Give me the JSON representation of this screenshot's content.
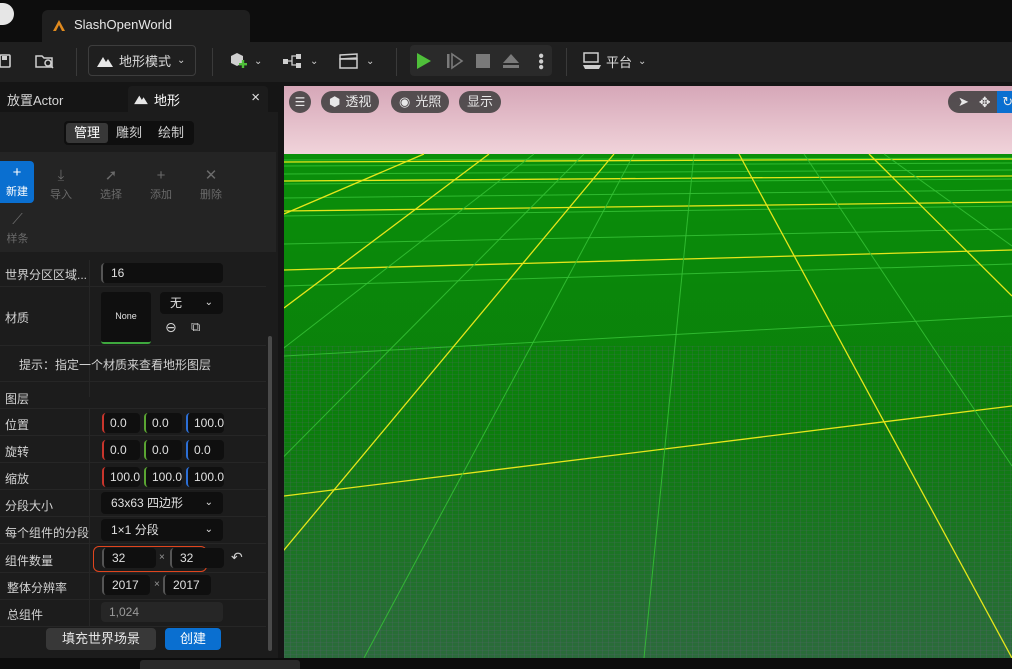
{
  "app": {
    "tab_title": "SlashOpenWorld",
    "logo_icon": "unreal-logo-icon",
    "accent_color": "#0a6fd0"
  },
  "toolbar": {
    "mode_label": "地形模式",
    "platform_label": "平台",
    "play_color": "#4fbf3a"
  },
  "left_panel": {
    "tabs": [
      {
        "label": "放置Actor"
      },
      {
        "label": "地形",
        "close": "×"
      }
    ],
    "segments": [
      "管理",
      "雕刻",
      "绘制"
    ],
    "active_segment": "管理",
    "tools": [
      {
        "label": "新建",
        "icon": "plus-icon",
        "active": true
      },
      {
        "label": "导入",
        "icon": "import-icon"
      },
      {
        "label": "选择",
        "icon": "select-icon"
      },
      {
        "label": "添加",
        "icon": "add-icon"
      },
      {
        "label": "删除",
        "icon": "delete-icon"
      },
      {
        "label": "样条",
        "icon": "spline-icon"
      }
    ],
    "properties": {
      "world_partition": {
        "label": "世界分区区域...",
        "value": "16"
      },
      "material": {
        "label": "材质",
        "thumb": "None",
        "dropdown": "无"
      },
      "hint": "提示：指定一个材质来查看地形图层",
      "layers_label": "图层",
      "location": {
        "label": "位置",
        "x": "0.0",
        "y": "0.0",
        "z": "100.0"
      },
      "rotation": {
        "label": "旋转",
        "x": "0.0",
        "y": "0.0",
        "z": "0.0"
      },
      "scale": {
        "label": "缩放",
        "x": "100.0",
        "y": "100.0",
        "z": "100.0"
      },
      "section_size": {
        "label": "分段大小",
        "value": "63x63 四边形"
      },
      "sections_per_component": {
        "label": "每个组件的分段",
        "value": "1×1 分段"
      },
      "component_count": {
        "label": "组件数量",
        "x": "32",
        "y": "32",
        "sep": "×"
      },
      "overall_resolution": {
        "label": "整体分辨率",
        "x": "2017",
        "y": "2017",
        "sep": "×"
      },
      "total_components": {
        "label": "总组件",
        "value": "1,024"
      }
    },
    "buttons": {
      "fill_world": "填充世界场景",
      "create": "创建"
    }
  },
  "viewport": {
    "menu_icon": "hamburger-icon",
    "perspective": "透视",
    "lit": "光照",
    "show": "显示",
    "landscape_color": "#0b8a0b",
    "grid_color_major": "#e6e61a",
    "grid_color_minor": "#36c236"
  }
}
